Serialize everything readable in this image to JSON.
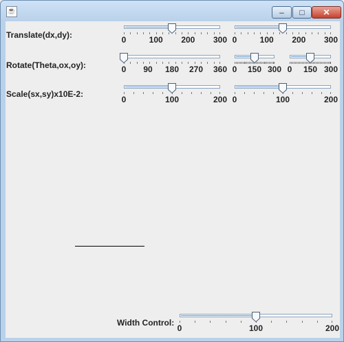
{
  "window": {
    "minimize_glyph": "–",
    "maximize_glyph": "□",
    "close_glyph": "✕",
    "app_icon_glyph": "☕"
  },
  "controls": {
    "translate_label": "Translate(dx,dy):",
    "rotate_label": "Rotate(Theta,ox,oy):",
    "scale_label": "Scale(sx,sy)x10E-2:",
    "width_label": "Width Control:"
  },
  "sliders": {
    "translate_dx": {
      "min": 0,
      "max": 300,
      "value": 150,
      "labels": [
        "0",
        "100",
        "200",
        "300"
      ],
      "minor": 20
    },
    "translate_dy": {
      "min": 0,
      "max": 300,
      "value": 150,
      "labels": [
        "0",
        "100",
        "200",
        "300"
      ],
      "minor": 20
    },
    "rotate_theta": {
      "min": 0,
      "max": 360,
      "value": 0,
      "labels": [
        "0",
        "90",
        "180",
        "270",
        "360"
      ],
      "minor": 24
    },
    "rotate_ox": {
      "min": 0,
      "max": 300,
      "value": 150,
      "labels": [
        "0",
        "150",
        "300"
      ],
      "minor": 10
    },
    "rotate_oy": {
      "min": 0,
      "max": 300,
      "value": 150,
      "labels": [
        "0",
        "150",
        "300"
      ],
      "minor": 10
    },
    "scale_sx": {
      "min": 0,
      "max": 200,
      "value": 100,
      "labels": [
        "0",
        "100",
        "200"
      ],
      "minor": 20
    },
    "scale_sy": {
      "min": 0,
      "max": 200,
      "value": 100,
      "labels": [
        "0",
        "100",
        "200"
      ],
      "minor": 20
    },
    "width": {
      "min": 0,
      "max": 200,
      "value": 100,
      "labels": [
        "0",
        "100",
        "200"
      ],
      "minor": 20
    }
  }
}
